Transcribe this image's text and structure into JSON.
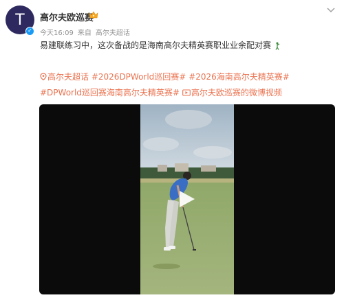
{
  "author": {
    "avatar_letter": "T",
    "name": "高尔夫欧巡赛",
    "badge_icon": "crown-icon",
    "verified_icon": "verified-icon"
  },
  "meta": {
    "time": "今天16:09",
    "source_prefix": "来自",
    "source": "高尔夫超话"
  },
  "post": {
    "text": "易建联练习中，这次备战的是海南高尔夫精英赛职业业余配对赛",
    "emoji": "golfer-icon"
  },
  "tags": [
    {
      "type": "location",
      "icon": "location-icon",
      "text": "高尔夫超话"
    },
    {
      "type": "hashtag",
      "text": "#2026DPWorld巡回赛#"
    },
    {
      "type": "hashtag",
      "text": "#2026海南高尔夫精英赛#"
    },
    {
      "type": "hashtag",
      "text": "#DPWorld巡回赛海南高尔夫精英赛#"
    },
    {
      "type": "video",
      "icon": "video-link-icon",
      "text": "高尔夫欧巡赛的微博视频"
    }
  ],
  "video": {
    "play_icon": "play-icon"
  },
  "colors": {
    "link": "#eb7350",
    "avatar_bg": "#2e2a5f",
    "meta": "#939393",
    "verified": "#1a9af5"
  }
}
